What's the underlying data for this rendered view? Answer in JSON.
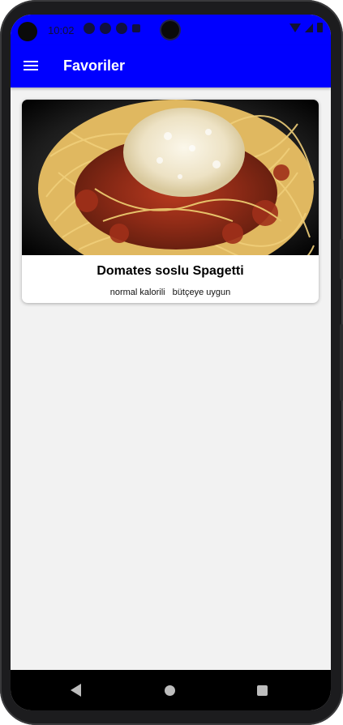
{
  "status_bar": {
    "time": "10:02"
  },
  "app_bar": {
    "title": "Favoriler",
    "menu_icon": "hamburger-menu-icon"
  },
  "favorites": [
    {
      "title": "Domates soslu Spagetti",
      "tags": [
        "normal kalorili",
        "bütçeye uygun"
      ],
      "image": "spaghetti-bolognese-with-parmesan"
    }
  ],
  "nav_bar": {
    "back_icon": "back-triangle-icon",
    "home_icon": "home-circle-icon",
    "recents_icon": "recents-square-icon"
  },
  "colors": {
    "app_bar": "#0000ff",
    "background": "#f2f2f2",
    "card": "#ffffff"
  }
}
